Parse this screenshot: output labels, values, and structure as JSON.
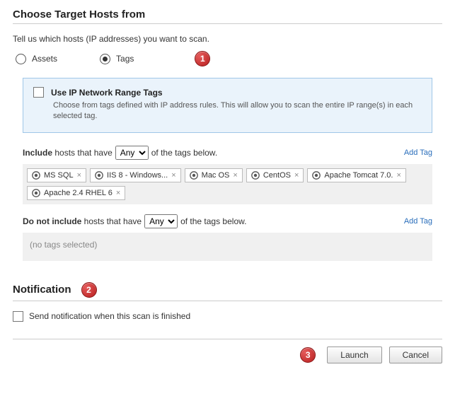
{
  "hosts": {
    "title": "Choose Target Hosts from",
    "instruction": "Tell us which hosts (IP addresses) you want to scan.",
    "radio_assets": "Assets",
    "radio_tags": "Tags",
    "annot1": "1",
    "ip_range": {
      "title": "Use IP Network Range Tags",
      "desc": "Choose from tags defined with IP address rules. This will allow you to scan the entire IP range(s) in each selected tag."
    },
    "include": {
      "prefix_bold": "Include",
      "prefix_rest": " hosts that have ",
      "selector": "Any",
      "suffix": " of the tags below.",
      "add_tag": "Add Tag",
      "tags": [
        "MS SQL",
        "IIS 8 - Windows...",
        "Mac OS",
        "CentOS",
        "Apache Tomcat 7.0.",
        "Apache 2.4 RHEL 6"
      ]
    },
    "exclude": {
      "prefix_bold": "Do not include",
      "prefix_rest": " hosts that have ",
      "selector": "Any",
      "suffix": " of the tags below.",
      "add_tag": "Add Tag",
      "empty_text": "(no tags selected)"
    }
  },
  "notification": {
    "title": "Notification",
    "annot2": "2",
    "checkbox_label": "Send notification when this scan is finished"
  },
  "footer": {
    "annot3": "3",
    "launch": "Launch",
    "cancel": "Cancel"
  }
}
